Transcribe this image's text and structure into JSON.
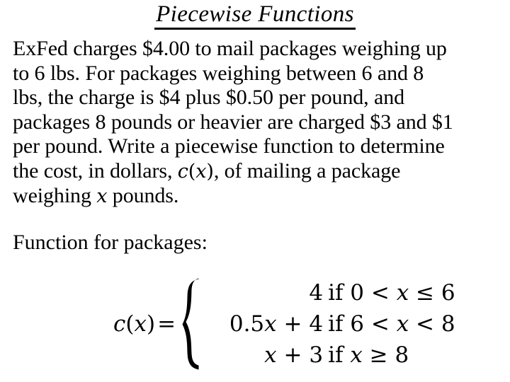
{
  "slide": {
    "title": "Piecewise Functions",
    "background_color": "#ffffff",
    "text_color": "#000000"
  },
  "body": {
    "lines": [
      "ExFed charges $4.00 to mail packages weighing up",
      "to 6 lbs.  For packages weighing between 6 and 8",
      "lbs, the charge is $4 plus $0.50 per pound, and",
      "packages 8 pounds or heavier are charged $3 and $1",
      "per pound. Write a piecewise function to determine"
    ],
    "line6_prefix": "the cost, in dollars, ",
    "line6_math_c": "c",
    "line6_math_paren_open": "(",
    "line6_math_x": "x",
    "line6_math_paren_close": ")",
    "line6_suffix": ", of mailing a package",
    "line7_prefix": "weighing ",
    "line7_math_x": "x",
    "line7_suffix": " pounds.",
    "function_label": "Function for packages:"
  },
  "formula": {
    "lhs_function": "c",
    "lhs_paren_open": "(",
    "lhs_variable": "x",
    "lhs_paren_close": ")",
    "lhs_equals": "=",
    "brace_symbol": "{",
    "cases": [
      {
        "expression": "4",
        "condition": "if 0 < x ≤ 6",
        "cond_pre": "if 0 < ",
        "cond_var": "x",
        "cond_post": " ≤ 6"
      },
      {
        "expression": "0.5x + 4",
        "expr_num": "0.5",
        "expr_var": "x",
        "expr_rest": " + 4",
        "condition": "if 6 < x < 8",
        "cond_pre": "if 6 < ",
        "cond_var": "x",
        "cond_post": " < 8"
      },
      {
        "expression": "x + 3",
        "expr_num": "",
        "expr_var": "x",
        "expr_rest": " + 3",
        "condition": "if x ≥ 8",
        "cond_pre": "if ",
        "cond_var": "x",
        "cond_post": " ≥ 8"
      }
    ]
  }
}
